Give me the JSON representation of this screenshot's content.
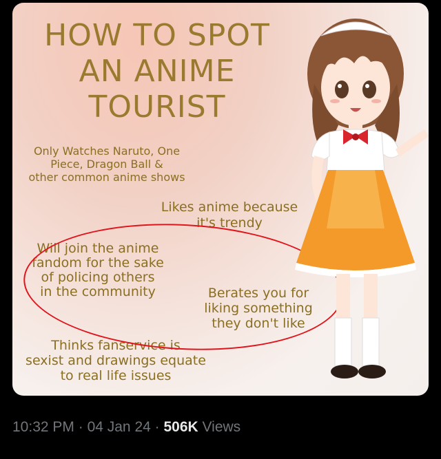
{
  "image": {
    "title_lines": [
      "HOW TO SPOT",
      "AN ANIME",
      "TOURIST"
    ],
    "notes": {
      "common_shows": [
        "Only Watches Naruto, One",
        "Piece, Dragon Ball &",
        "other common anime shows"
      ],
      "trendy": [
        "Likes anime because",
        "it's trendy"
      ],
      "policing": [
        "Will join the anime",
        "fandom for the sake",
        "of policing others",
        "in the community"
      ],
      "berates": [
        "Berates you for",
        "liking something",
        "they don't like"
      ],
      "fanservice": [
        "Thinks fanservice is",
        "sexist and drawings equate",
        "to real life issues"
      ]
    },
    "highlight_color": "#e0141a",
    "character": "maid-girl-illustration"
  },
  "footer": {
    "time": "10:32 PM",
    "sep1": " · ",
    "date": "04 Jan 24",
    "sep2": " · ",
    "views_count": "506K",
    "views_label": " Views"
  }
}
